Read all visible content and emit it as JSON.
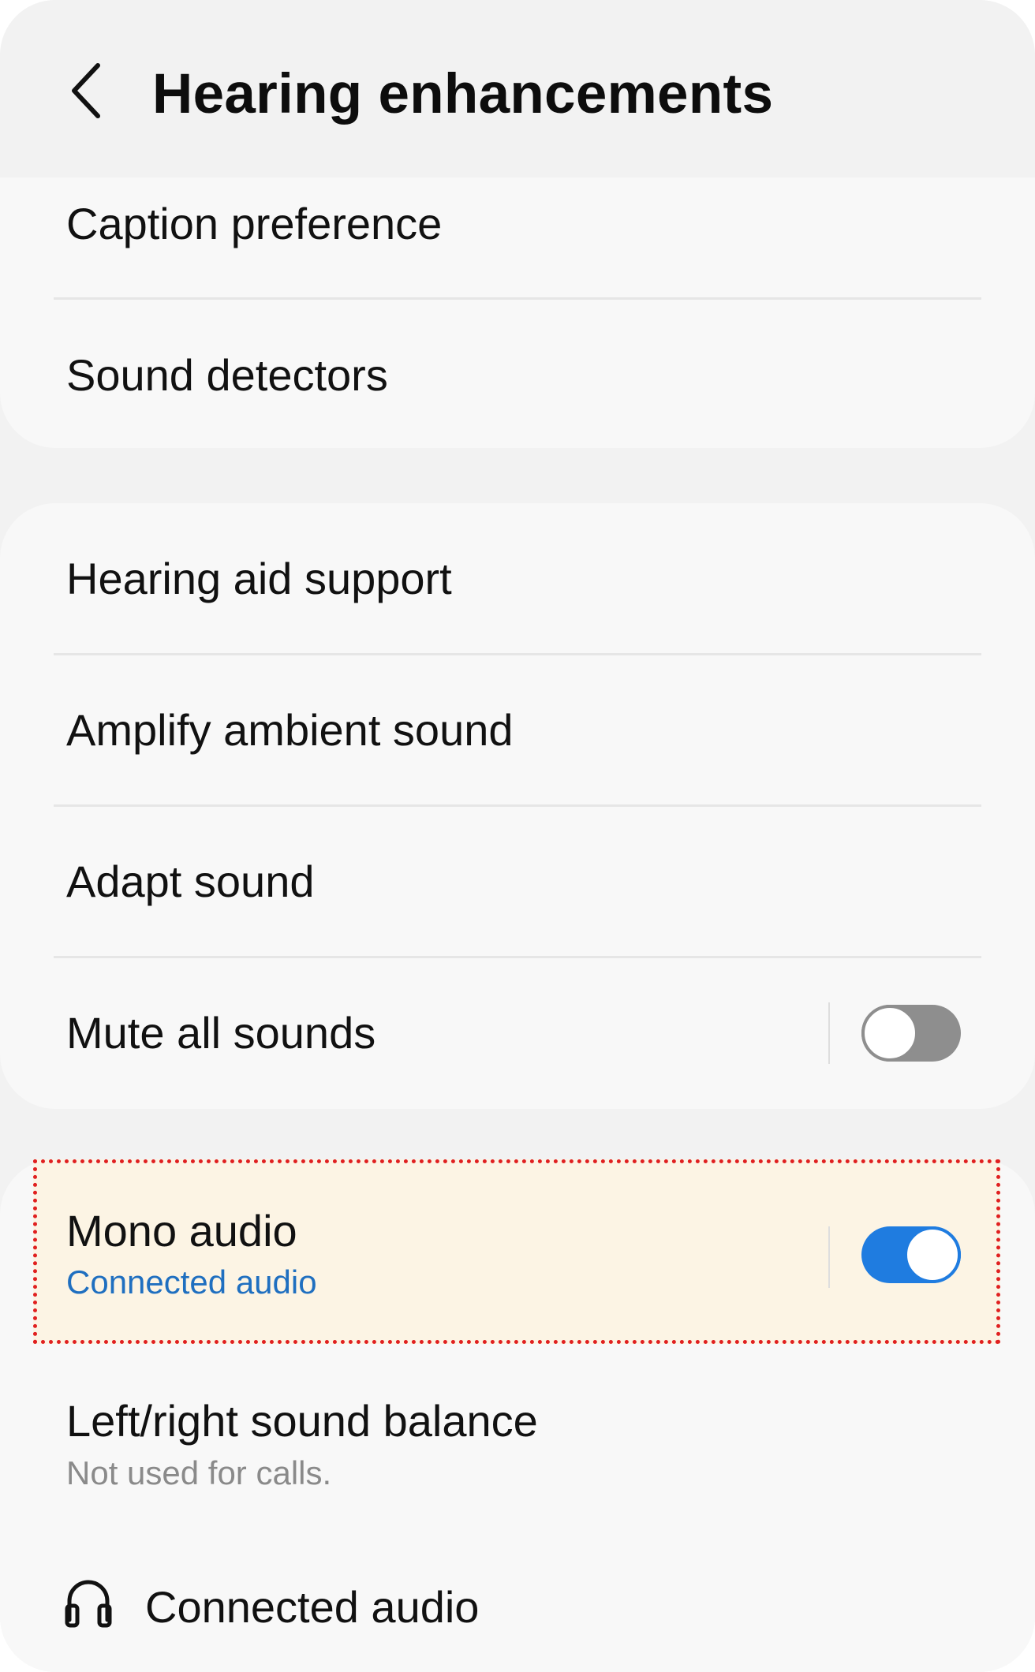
{
  "header": {
    "title": "Hearing enhancements",
    "back_icon": "chevron-left-icon"
  },
  "group1": {
    "items": [
      {
        "label": "Caption preference"
      },
      {
        "label": "Sound detectors"
      }
    ]
  },
  "group2": {
    "items": [
      {
        "label": "Hearing aid support"
      },
      {
        "label": "Amplify ambient sound"
      },
      {
        "label": "Adapt sound"
      },
      {
        "label": "Mute all sounds",
        "toggle": "off"
      }
    ]
  },
  "group3": {
    "mono_audio": {
      "label": "Mono audio",
      "subtitle": "Connected audio",
      "toggle": "on",
      "highlighted": true
    },
    "balance": {
      "label": "Left/right sound balance",
      "subtitle": "Not used for calls."
    },
    "connected_audio": {
      "label": "Connected audio",
      "icon": "headphones-icon"
    }
  },
  "colors": {
    "accent": "#1f7ce0",
    "subtitle_link": "#1f6fc0",
    "subtitle_muted": "#8a8a8a",
    "highlight_fill": "#fcf4e4",
    "highlight_border": "#e02020"
  }
}
